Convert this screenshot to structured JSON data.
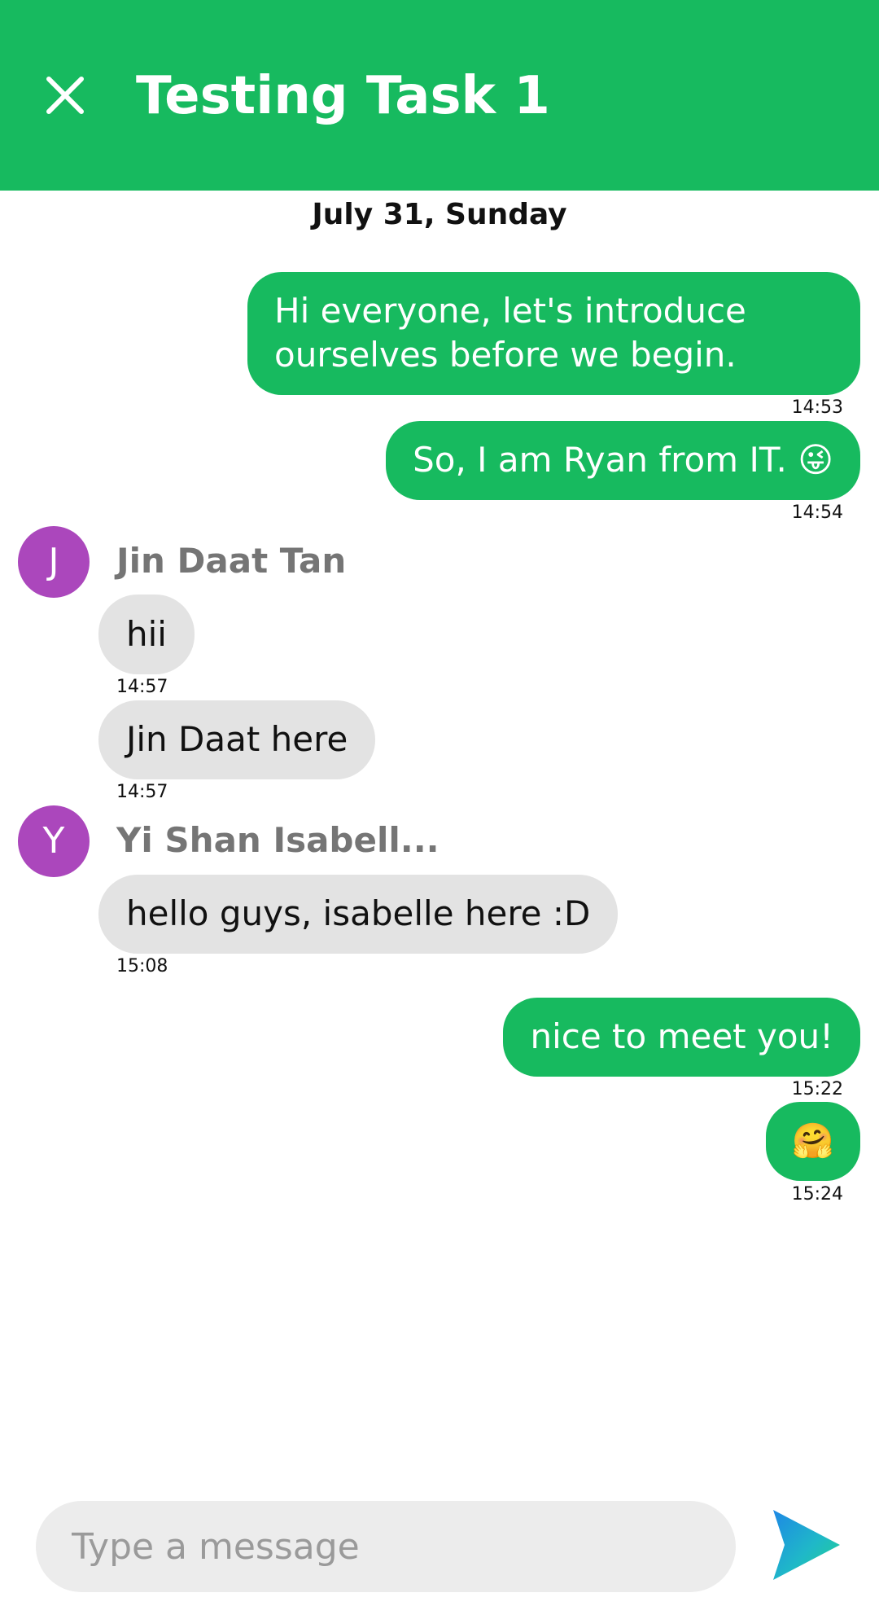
{
  "header": {
    "title": "Testing Task 1",
    "close_icon": "close-icon",
    "background": "#17ba5f"
  },
  "date_separator": "July 31, Sunday",
  "messages": [
    {
      "direction": "outgoing",
      "lines": [
        "Hi everyone, let's introduce",
        "ourselves before we begin."
      ],
      "time": "14:53"
    },
    {
      "direction": "outgoing",
      "text": "So, I am Ryan from IT. 😜",
      "time": "14:54"
    },
    {
      "direction": "incoming",
      "sender": "Jin Daat Tan",
      "avatar_letter": "J",
      "text": "hii",
      "time": "14:57"
    },
    {
      "direction": "incoming",
      "text": "Jin Daat here",
      "time": "14:57"
    },
    {
      "direction": "incoming",
      "sender": "Yi Shan Isabell...",
      "avatar_letter": "Y",
      "text": "hello guys, isabelle here :D",
      "time": "15:08"
    },
    {
      "direction": "outgoing",
      "text": "nice to meet you!",
      "time": "15:22"
    },
    {
      "direction": "outgoing",
      "text": "🤗",
      "time": "15:24"
    }
  ],
  "composer": {
    "placeholder": "Type a message",
    "value": "",
    "send_icon": "send-icon"
  },
  "colors": {
    "accent": "#17ba5f",
    "incoming_bubble": "#e3e3e3",
    "avatar": "#ab47bc",
    "sender_name": "#757575"
  }
}
